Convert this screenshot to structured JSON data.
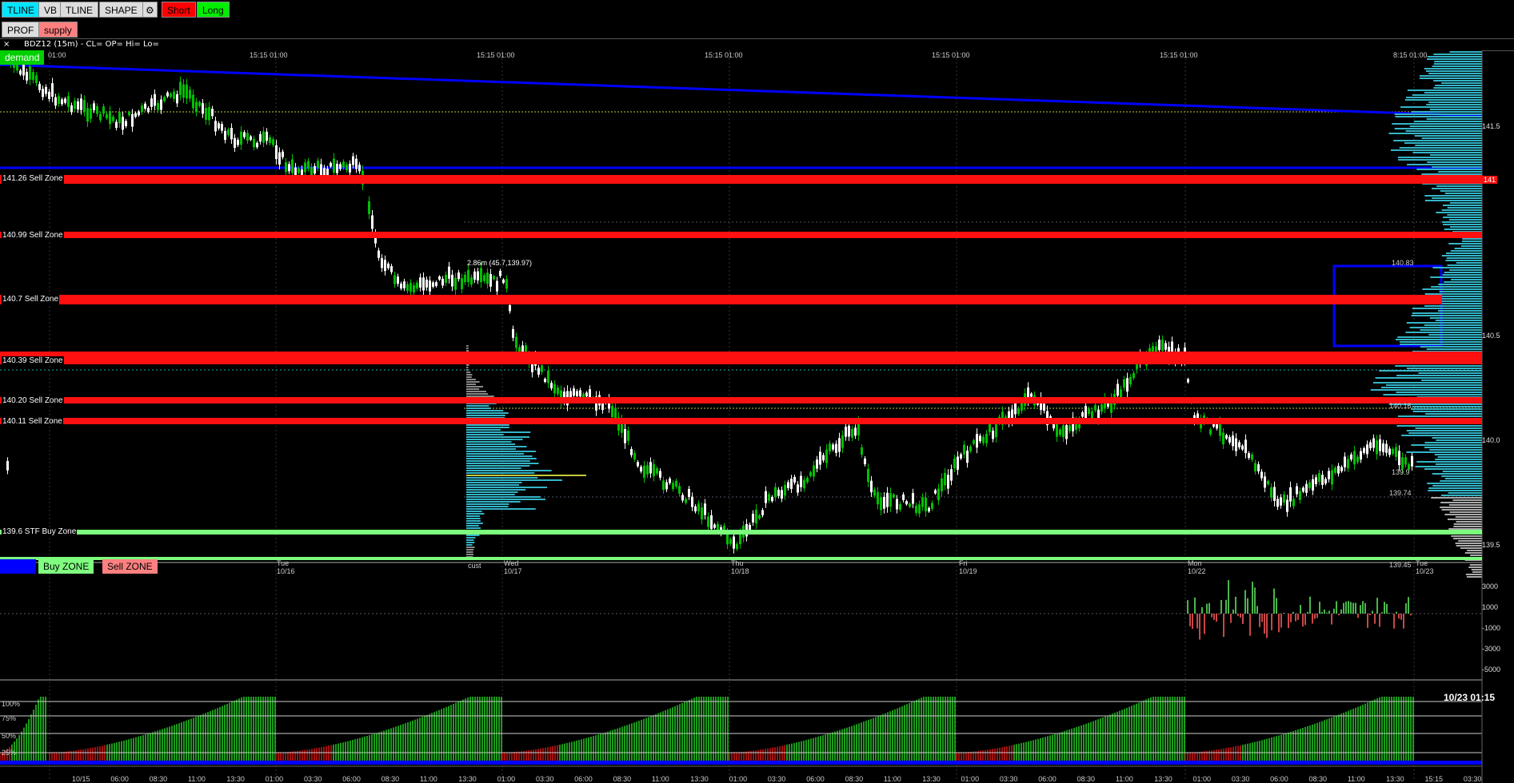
{
  "toolbar": {
    "buttons": [
      {
        "label": "TLINE",
        "bg": "#00e5ff"
      },
      {
        "label": "VB",
        "bg": "#dddddd"
      },
      {
        "label": "TLINE",
        "bg": "#dddddd"
      },
      {
        "label": "SHAPE",
        "bg": "#dddddd"
      },
      {
        "label": "⚙",
        "bg": "#dddddd"
      },
      {
        "label": "Short",
        "bg": "#ff0000"
      },
      {
        "label": "Long",
        "bg": "#00ee00"
      }
    ],
    "row2": [
      {
        "label": "PROF",
        "bg": "#dddddd"
      },
      {
        "label": "supply",
        "bg": "#ff8080"
      }
    ]
  },
  "info": {
    "close_label": "×",
    "symbol": "BDZ12 (15m) - CL= OP= Hi= Lo="
  },
  "demand_button": "demand",
  "zones": [
    {
      "label": "141.26 Sell Zone",
      "price": 141.26
    },
    {
      "label": "140.99 Sell Zone",
      "price": 140.99
    },
    {
      "label": "140.7 Sell Zone",
      "price": 140.7
    },
    {
      "label": "140.39 Sell Zone",
      "price": 140.39
    },
    {
      "label": "140.20 Sell Zone",
      "price": 140.2
    },
    {
      "label": "140.11 Sell Zone",
      "price": 140.11
    }
  ],
  "buy_zones": [
    {
      "label": "139.6 STF Buy Zone",
      "price": 139.6
    }
  ],
  "annotations": {
    "vol_note": "2.86m (45.7,139.97)",
    "p1": "140.83",
    "p2": "140.16",
    "p3": "139.9",
    "p4": "139.74",
    "p5": "139.45",
    "cust": "cust"
  },
  "top_time_labels": [
    "01:00",
    "15:15 01:00",
    "15:15 01:00",
    "15:15 01:00",
    "15:15 01:00",
    "15:15 01:00",
    "8:15 01:00"
  ],
  "right_axis": [
    "141.5",
    "141",
    "140.5",
    "140.0",
    "139.5"
  ],
  "day_labels": [
    {
      "d": "Tue",
      "m": "10/16"
    },
    {
      "d": "Wed",
      "m": "10/17"
    },
    {
      "d": "Thu",
      "m": "10/18"
    },
    {
      "d": "Fri",
      "m": "10/19"
    },
    {
      "d": "Mon",
      "m": "10/22"
    },
    {
      "d": "Tue",
      "m": "10/23"
    }
  ],
  "legend_buttons": [
    {
      "label": "Buy ZONE",
      "bg": "#80ff80"
    },
    {
      "label": "Sell ZONE",
      "bg": "#ff8080"
    }
  ],
  "osc_axis": [
    "3000",
    "1000",
    "-1000",
    "-3000",
    "-5000"
  ],
  "pct_axis": [
    "100%",
    "75%",
    "50%",
    "25%"
  ],
  "bottom_right": "10/23 01:15",
  "bottom_times": [
    "10/15",
    "06:00",
    "08:30",
    "11:00",
    "13:30",
    "01:00",
    "03:30",
    "06:00",
    "08:30",
    "11:00",
    "13:30",
    "01:00",
    "03:30",
    "06:00",
    "08:30",
    "11:00",
    "13:30",
    "01:00",
    "03:30",
    "06:00",
    "08:30",
    "11:00",
    "13:30",
    "01:00",
    "03:30",
    "06:00",
    "08:30",
    "11:00",
    "13:30",
    "01:00",
    "03:30",
    "06:00",
    "08:30",
    "11:00",
    "13:30",
    "15:15",
    "03:30"
  ],
  "colors": {
    "sell": "#ff1010",
    "buy": "#7cfc7c",
    "trend": "#0000ff",
    "profile": "#33b5c8"
  }
}
